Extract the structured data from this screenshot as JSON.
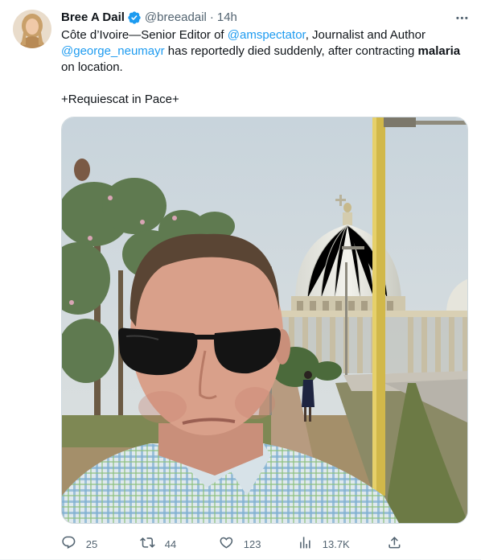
{
  "tweet": {
    "author": {
      "display_name": "Bree A Dail",
      "handle": "@breeadail",
      "verified": true,
      "avatar": "author-avatar"
    },
    "separator": "·",
    "time": "14h",
    "text": {
      "line1_a": "Côte d’Ivoire—Senior Editor of ",
      "mention1": "@amspectator",
      "line1_b": ", Journalist and Author",
      "mention2": "@george_neumayr",
      "line2_a": " has reportedly died suddenly, after contracting ",
      "line2_bold": "malaria",
      "line3": "on location.",
      "line4": "+Requiescat in Pace+"
    },
    "media": {
      "type": "photo",
      "description_icon": "selfie-photo"
    },
    "actions": {
      "reply_count": "25",
      "retweet_count": "44",
      "like_count": "123",
      "view_count": "13.7K"
    }
  },
  "colors": {
    "text_primary": "#0f1419",
    "text_secondary": "#536471",
    "link": "#1d9bf0",
    "verified": "#1d9bf0"
  }
}
